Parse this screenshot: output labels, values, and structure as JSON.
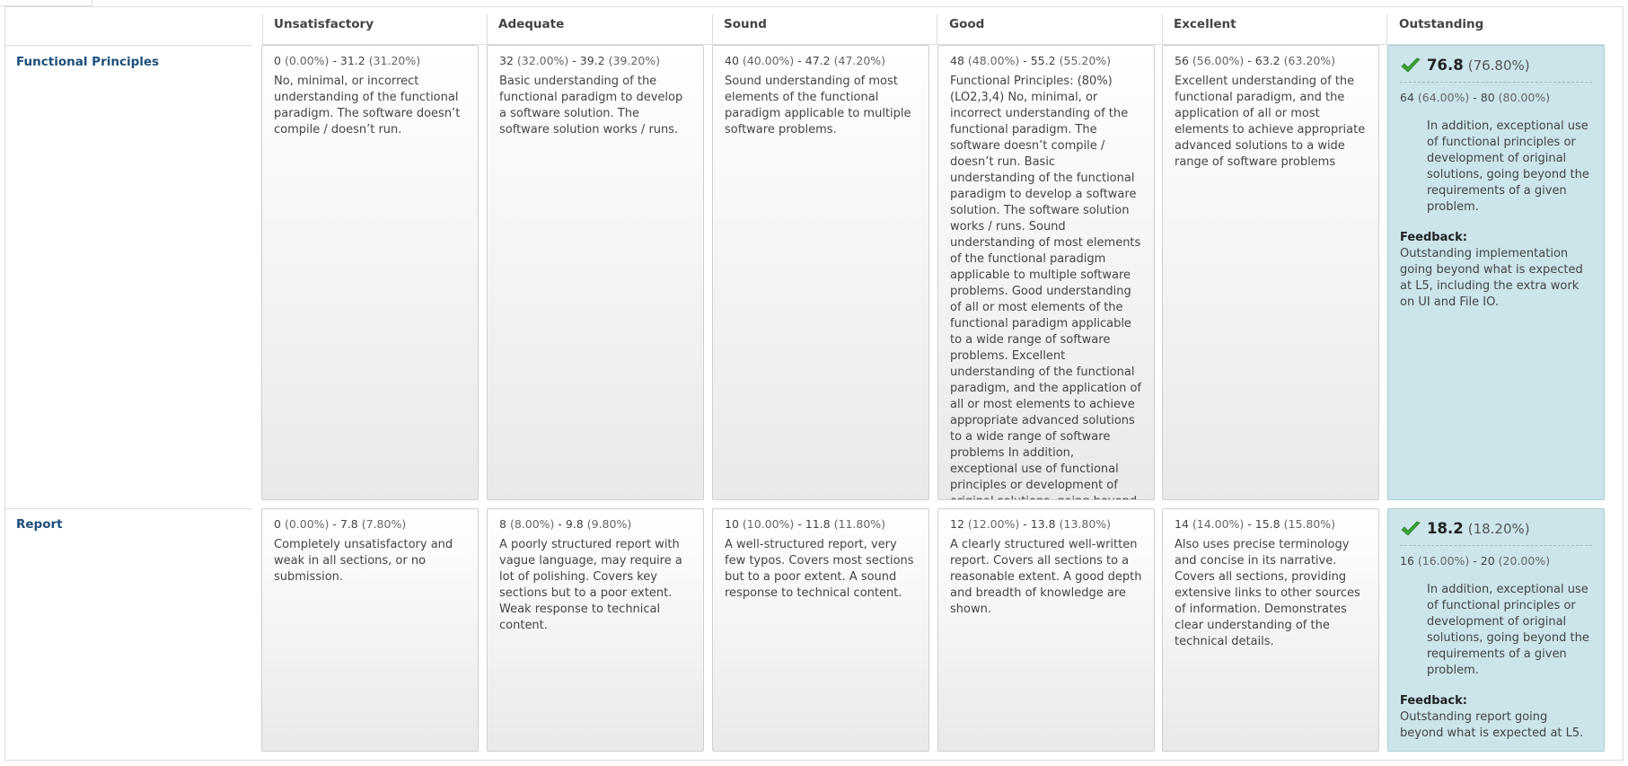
{
  "columns": [
    "Unsatisfactory",
    "Adequate",
    "Sound",
    "Good",
    "Excellent",
    "Outstanding"
  ],
  "rows": [
    {
      "name": "Functional Principles",
      "cells": [
        {
          "low": "0",
          "low_pct": "(0.00%)",
          "high": "31.2",
          "high_pct": "(31.20%)",
          "description": "No, minimal, or incorrect understanding of the functional paradigm. The software doesn’t compile / doesn’t run."
        },
        {
          "low": "32",
          "low_pct": "(32.00%)",
          "high": "39.2",
          "high_pct": "(39.20%)",
          "description": "Basic understanding of the functional paradigm to develop a software solution. The software solution works / runs."
        },
        {
          "low": "40",
          "low_pct": "(40.00%)",
          "high": "47.2",
          "high_pct": "(47.20%)",
          "description": "Sound understanding of most elements of the functional paradigm applicable to multiple software problems."
        },
        {
          "low": "48",
          "low_pct": "(48.00%)",
          "high": "55.2",
          "high_pct": "(55.20%)",
          "description": "Functional Principles: (80%) (LO2,3,4) No, minimal, or incorrect understanding of the functional paradigm. The software doesn’t compile / doesn’t run. Basic understanding of the functional paradigm to develop a software solution. The software solution works / runs. Sound understanding of most elements of the functional paradigm applicable to multiple software problems. Good understanding of all or most elements of the functional paradigm applicable to a wide range of software problems. Excellent understanding of the functional paradigm, and the application of all or most elements to achieve appropriate advanced solutions to a wide range of software problems In addition, exceptional use of functional principles or development of original solutions, going beyond the requirements of a given problem."
        },
        {
          "low": "56",
          "low_pct": "(56.00%)",
          "high": "63.2",
          "high_pct": "(63.20%)",
          "description": "Excellent understanding of the functional paradigm, and the application of all or most elements to achieve appropriate advanced solutions to a wide range of software problems"
        }
      ],
      "selected": {
        "score": "76.8",
        "score_pct": "(76.80%)",
        "low": "64",
        "low_pct": "(64.00%)",
        "high": "80",
        "high_pct": "(80.00%)",
        "description": "In addition, exceptional use of functional principles or development of original solutions, going beyond the requirements of a given problem.",
        "feedback_label": "Feedback:",
        "feedback": "Outstanding implementation going beyond what is expected at L5, including the extra work on UI and File IO."
      }
    },
    {
      "name": "Report",
      "cells": [
        {
          "low": "0",
          "low_pct": "(0.00%)",
          "high": "7.8",
          "high_pct": "(7.80%)",
          "description": "Completely unsatisfactory and weak in all sections, or no submission."
        },
        {
          "low": "8",
          "low_pct": "(8.00%)",
          "high": "9.8",
          "high_pct": "(9.80%)",
          "description": "A poorly structured report with vague language, may require a lot of polishing. Covers key sections but to a poor extent. Weak response to technical content."
        },
        {
          "low": "10",
          "low_pct": "(10.00%)",
          "high": "11.8",
          "high_pct": "(11.80%)",
          "description": "A well-structured report, very few typos. Covers most sections but to a poor extent. A sound response to technical content."
        },
        {
          "low": "12",
          "low_pct": "(12.00%)",
          "high": "13.8",
          "high_pct": "(13.80%)",
          "description": "A clearly structured well-written report. Covers all sections to a reasonable extent. A good depth and breadth of knowledge are shown."
        },
        {
          "low": "14",
          "low_pct": "(14.00%)",
          "high": "15.8",
          "high_pct": "(15.80%)",
          "description": "Also uses precise terminology and concise in its narrative. Covers all sections, providing extensive links to other sources of information. Demonstrates clear understanding of the technical details."
        }
      ],
      "selected": {
        "score": "18.2",
        "score_pct": "(18.20%)",
        "low": "16",
        "low_pct": "(16.00%)",
        "high": "20",
        "high_pct": "(20.00%)",
        "description": "In addition, exceptional use of functional principles or development of original solutions, going beyond the requirements of a given problem.",
        "feedback_label": "Feedback:",
        "feedback": "Outstanding report going beyond what is expected at L5."
      }
    }
  ],
  "colors": {
    "selected_bg": "#cbe5ea",
    "row_label": "#1a4f7a",
    "check": "#3aa335"
  },
  "icons": {
    "selected": "checkmark-icon"
  }
}
